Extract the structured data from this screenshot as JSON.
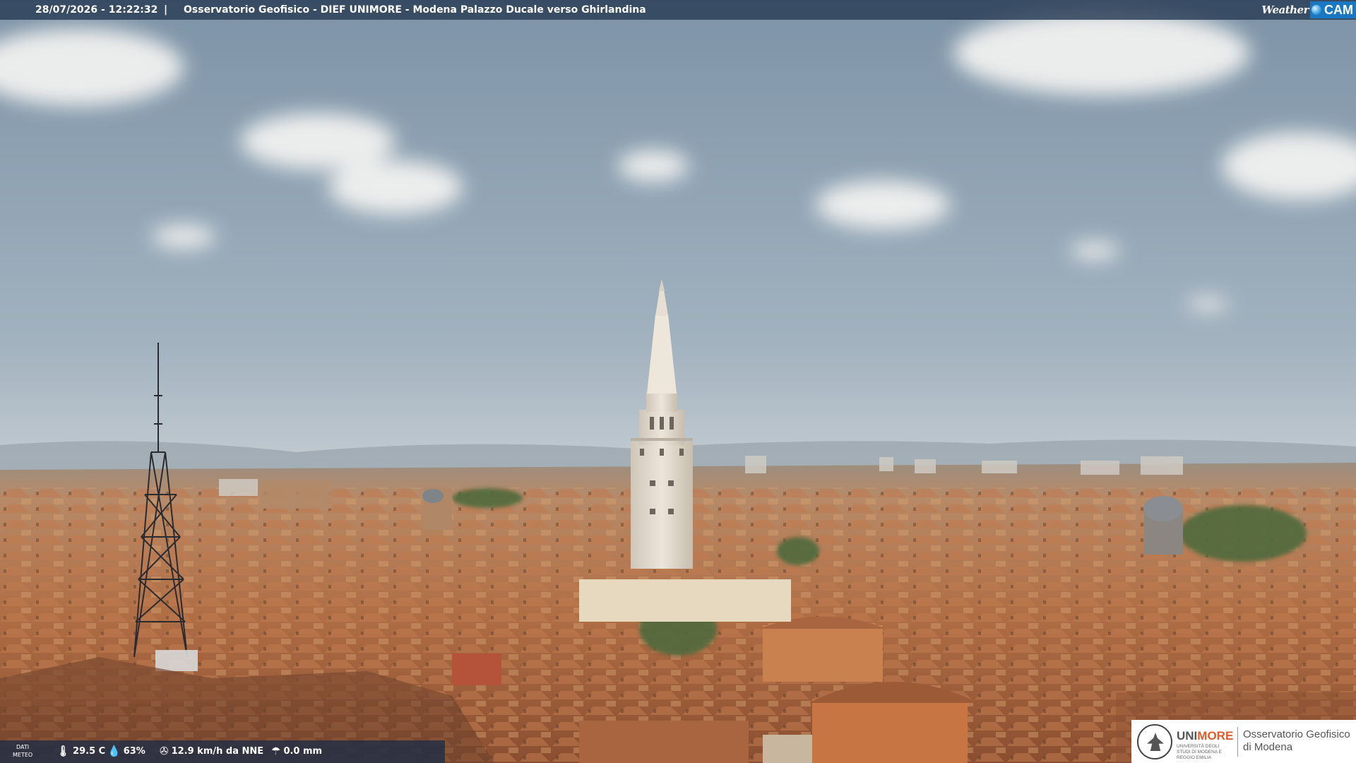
{
  "header": {
    "datetime": "28/07/2026 - 12:22:32",
    "separator": "|",
    "title": "Osservatorio Geofisico - DIEF UNIMORE - Modena Palazzo Ducale verso Ghirlandina",
    "brand_weather": "Weather",
    "brand_cam": "CAM"
  },
  "meteo": {
    "label_line1": "DATI",
    "label_line2": "METEO",
    "temperature": "29.5 C",
    "humidity": "63%",
    "wind": "12.9 km/h da NNE",
    "rain": "0.0 mm",
    "icons": [
      "thermometer-icon",
      "humidity-drop-icon",
      "wind-turbine-icon",
      "rain-gauge-icon"
    ]
  },
  "logo": {
    "uni_prefix": "UNI",
    "uni_suffix": "MORE",
    "uni_subtitle": "UNIVERSITÀ DEGLI STUDI DI MODENA E REGGIO EMILIA",
    "observatory_line1": "Osservatorio Geofisico",
    "observatory_line2": "di Modena"
  },
  "colors": {
    "sky_top": "#7f95a8",
    "sky_horizon": "#c6cfd5",
    "roof": "#b5704a",
    "tower": "#e2d9cb",
    "brand_blue": "#1a78c2",
    "unimore_orange": "#e25b2a"
  }
}
